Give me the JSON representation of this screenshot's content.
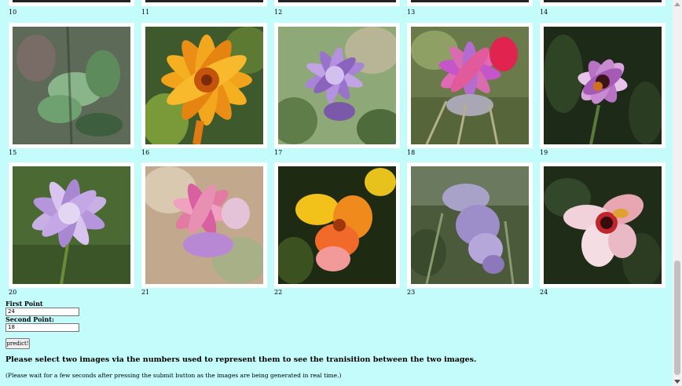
{
  "top_row": {
    "labels": [
      "10",
      "11",
      "12",
      "13",
      "14"
    ]
  },
  "grid": {
    "rows": [
      {
        "labels": [
          "15",
          "16",
          "17",
          "18",
          "19"
        ]
      },
      {
        "labels": [
          "20",
          "21",
          "22",
          "23",
          "24"
        ]
      }
    ]
  },
  "form": {
    "first_label": "First Point",
    "first_value": "24",
    "second_label": "Second Point:",
    "second_value": "18",
    "button_label": "predict!",
    "instructions": "Please select two images via the numbers used to represent them to see the tranisition between the two images.",
    "note": "(Please wait for a few seconds after pressing the submit button as the images are being generated in real time.)"
  },
  "colors": {
    "background": "#c4fbfb",
    "tile_border": "#ffffff"
  },
  "images": [
    "green-leaves",
    "orange-flower",
    "purple-thistle",
    "pink-flower",
    "dark-pink-flower",
    "lavender-thistle",
    "pink-lily",
    "yellow-orange-flower",
    "purple-wisteria",
    "white-pink-flower"
  ]
}
